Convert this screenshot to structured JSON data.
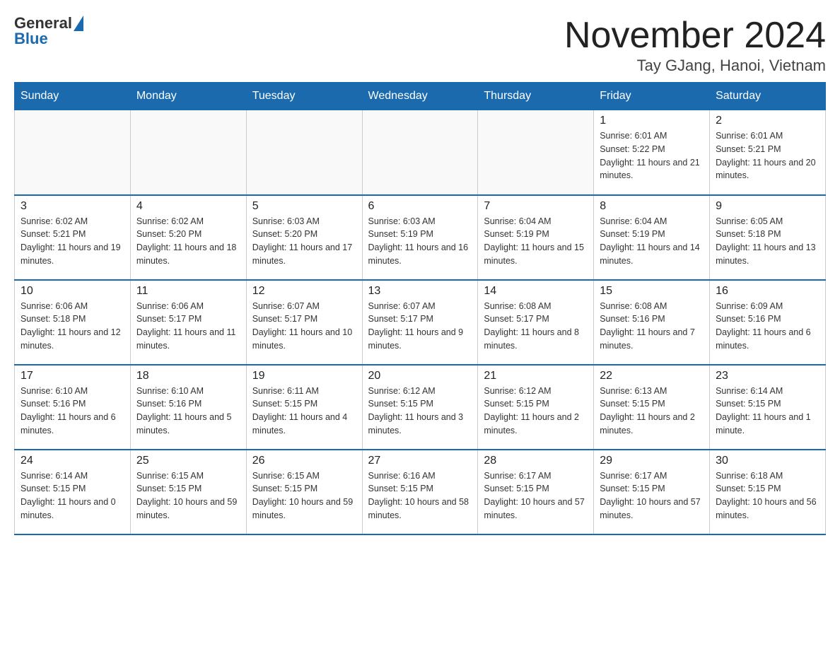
{
  "header": {
    "logo": {
      "general": "General",
      "blue": "Blue",
      "triangle_color": "#1a6aad"
    },
    "title": "November 2024",
    "subtitle": "Tay GJang, Hanoi, Vietnam"
  },
  "days_of_week": [
    "Sunday",
    "Monday",
    "Tuesday",
    "Wednesday",
    "Thursday",
    "Friday",
    "Saturday"
  ],
  "weeks": [
    {
      "days": [
        {
          "number": "",
          "info": ""
        },
        {
          "number": "",
          "info": ""
        },
        {
          "number": "",
          "info": ""
        },
        {
          "number": "",
          "info": ""
        },
        {
          "number": "",
          "info": ""
        },
        {
          "number": "1",
          "info": "Sunrise: 6:01 AM\nSunset: 5:22 PM\nDaylight: 11 hours and 21 minutes."
        },
        {
          "number": "2",
          "info": "Sunrise: 6:01 AM\nSunset: 5:21 PM\nDaylight: 11 hours and 20 minutes."
        }
      ]
    },
    {
      "days": [
        {
          "number": "3",
          "info": "Sunrise: 6:02 AM\nSunset: 5:21 PM\nDaylight: 11 hours and 19 minutes."
        },
        {
          "number": "4",
          "info": "Sunrise: 6:02 AM\nSunset: 5:20 PM\nDaylight: 11 hours and 18 minutes."
        },
        {
          "number": "5",
          "info": "Sunrise: 6:03 AM\nSunset: 5:20 PM\nDaylight: 11 hours and 17 minutes."
        },
        {
          "number": "6",
          "info": "Sunrise: 6:03 AM\nSunset: 5:19 PM\nDaylight: 11 hours and 16 minutes."
        },
        {
          "number": "7",
          "info": "Sunrise: 6:04 AM\nSunset: 5:19 PM\nDaylight: 11 hours and 15 minutes."
        },
        {
          "number": "8",
          "info": "Sunrise: 6:04 AM\nSunset: 5:19 PM\nDaylight: 11 hours and 14 minutes."
        },
        {
          "number": "9",
          "info": "Sunrise: 6:05 AM\nSunset: 5:18 PM\nDaylight: 11 hours and 13 minutes."
        }
      ]
    },
    {
      "days": [
        {
          "number": "10",
          "info": "Sunrise: 6:06 AM\nSunset: 5:18 PM\nDaylight: 11 hours and 12 minutes."
        },
        {
          "number": "11",
          "info": "Sunrise: 6:06 AM\nSunset: 5:17 PM\nDaylight: 11 hours and 11 minutes."
        },
        {
          "number": "12",
          "info": "Sunrise: 6:07 AM\nSunset: 5:17 PM\nDaylight: 11 hours and 10 minutes."
        },
        {
          "number": "13",
          "info": "Sunrise: 6:07 AM\nSunset: 5:17 PM\nDaylight: 11 hours and 9 minutes."
        },
        {
          "number": "14",
          "info": "Sunrise: 6:08 AM\nSunset: 5:17 PM\nDaylight: 11 hours and 8 minutes."
        },
        {
          "number": "15",
          "info": "Sunrise: 6:08 AM\nSunset: 5:16 PM\nDaylight: 11 hours and 7 minutes."
        },
        {
          "number": "16",
          "info": "Sunrise: 6:09 AM\nSunset: 5:16 PM\nDaylight: 11 hours and 6 minutes."
        }
      ]
    },
    {
      "days": [
        {
          "number": "17",
          "info": "Sunrise: 6:10 AM\nSunset: 5:16 PM\nDaylight: 11 hours and 6 minutes."
        },
        {
          "number": "18",
          "info": "Sunrise: 6:10 AM\nSunset: 5:16 PM\nDaylight: 11 hours and 5 minutes."
        },
        {
          "number": "19",
          "info": "Sunrise: 6:11 AM\nSunset: 5:15 PM\nDaylight: 11 hours and 4 minutes."
        },
        {
          "number": "20",
          "info": "Sunrise: 6:12 AM\nSunset: 5:15 PM\nDaylight: 11 hours and 3 minutes."
        },
        {
          "number": "21",
          "info": "Sunrise: 6:12 AM\nSunset: 5:15 PM\nDaylight: 11 hours and 2 minutes."
        },
        {
          "number": "22",
          "info": "Sunrise: 6:13 AM\nSunset: 5:15 PM\nDaylight: 11 hours and 2 minutes."
        },
        {
          "number": "23",
          "info": "Sunrise: 6:14 AM\nSunset: 5:15 PM\nDaylight: 11 hours and 1 minute."
        }
      ]
    },
    {
      "days": [
        {
          "number": "24",
          "info": "Sunrise: 6:14 AM\nSunset: 5:15 PM\nDaylight: 11 hours and 0 minutes."
        },
        {
          "number": "25",
          "info": "Sunrise: 6:15 AM\nSunset: 5:15 PM\nDaylight: 10 hours and 59 minutes."
        },
        {
          "number": "26",
          "info": "Sunrise: 6:15 AM\nSunset: 5:15 PM\nDaylight: 10 hours and 59 minutes."
        },
        {
          "number": "27",
          "info": "Sunrise: 6:16 AM\nSunset: 5:15 PM\nDaylight: 10 hours and 58 minutes."
        },
        {
          "number": "28",
          "info": "Sunrise: 6:17 AM\nSunset: 5:15 PM\nDaylight: 10 hours and 57 minutes."
        },
        {
          "number": "29",
          "info": "Sunrise: 6:17 AM\nSunset: 5:15 PM\nDaylight: 10 hours and 57 minutes."
        },
        {
          "number": "30",
          "info": "Sunrise: 6:18 AM\nSunset: 5:15 PM\nDaylight: 10 hours and 56 minutes."
        }
      ]
    }
  ]
}
